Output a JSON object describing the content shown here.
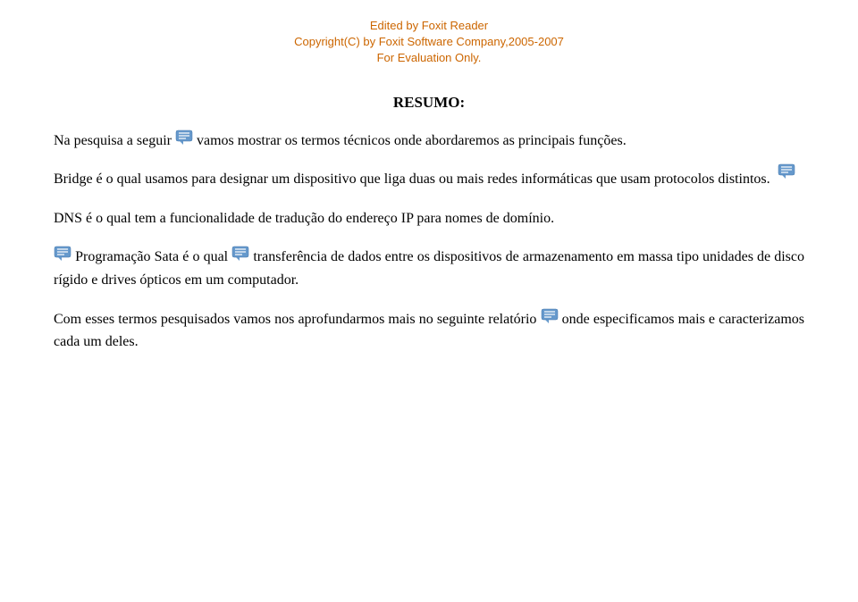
{
  "foxit": {
    "line1": "Edited by Foxit Reader",
    "line2": "Copyright(C) by Foxit Software Company,2005-2007",
    "line3": "For Evaluation Only."
  },
  "title": "RESUMO:",
  "paragraphs": {
    "p1": "Na pesquisa a seguir vamos mostrar os termos técnicos onde abordaremos as principais funções.",
    "p2": "Bridge é o qual usamos para designar um dispositivo que liga duas ou mais redes informáticas que usam protocolos distintos.",
    "p3": "DNS é o qual tem a funcionalidade de tradução do endereço IP para nomes de domínio.",
    "p4": "Programação Sata é o qual transferência de dados entre os dispositivos de armazenamento em massa tipo unidades de disco rígido e drives ópticos em um computador.",
    "p5": "Com esses termos pesquisados vamos nos aprofundarmos mais no seguinte relatório onde especificamos mais e caracterizamos cada um deles."
  },
  "icons": {
    "comment_color": "#6699cc"
  }
}
